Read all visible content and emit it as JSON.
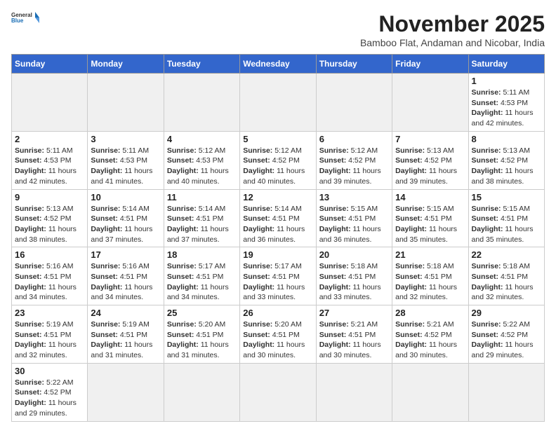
{
  "logo": {
    "line1": "General",
    "line2": "Blue"
  },
  "title": "November 2025",
  "subtitle": "Bamboo Flat, Andaman and Nicobar, India",
  "days_of_week": [
    "Sunday",
    "Monday",
    "Tuesday",
    "Wednesday",
    "Thursday",
    "Friday",
    "Saturday"
  ],
  "weeks": [
    [
      {
        "day": null,
        "info": null
      },
      {
        "day": null,
        "info": null
      },
      {
        "day": null,
        "info": null
      },
      {
        "day": null,
        "info": null
      },
      {
        "day": null,
        "info": null
      },
      {
        "day": null,
        "info": null
      },
      {
        "day": "1",
        "info": "Sunrise: 5:11 AM\nSunset: 4:53 PM\nDaylight: 11 hours and 42 minutes."
      }
    ],
    [
      {
        "day": "2",
        "info": "Sunrise: 5:11 AM\nSunset: 4:53 PM\nDaylight: 11 hours and 42 minutes."
      },
      {
        "day": "3",
        "info": "Sunrise: 5:11 AM\nSunset: 4:53 PM\nDaylight: 11 hours and 41 minutes."
      },
      {
        "day": "4",
        "info": "Sunrise: 5:12 AM\nSunset: 4:53 PM\nDaylight: 11 hours and 40 minutes."
      },
      {
        "day": "5",
        "info": "Sunrise: 5:12 AM\nSunset: 4:52 PM\nDaylight: 11 hours and 40 minutes."
      },
      {
        "day": "6",
        "info": "Sunrise: 5:12 AM\nSunset: 4:52 PM\nDaylight: 11 hours and 39 minutes."
      },
      {
        "day": "7",
        "info": "Sunrise: 5:13 AM\nSunset: 4:52 PM\nDaylight: 11 hours and 39 minutes."
      },
      {
        "day": "8",
        "info": "Sunrise: 5:13 AM\nSunset: 4:52 PM\nDaylight: 11 hours and 38 minutes."
      }
    ],
    [
      {
        "day": "9",
        "info": "Sunrise: 5:13 AM\nSunset: 4:52 PM\nDaylight: 11 hours and 38 minutes."
      },
      {
        "day": "10",
        "info": "Sunrise: 5:14 AM\nSunset: 4:51 PM\nDaylight: 11 hours and 37 minutes."
      },
      {
        "day": "11",
        "info": "Sunrise: 5:14 AM\nSunset: 4:51 PM\nDaylight: 11 hours and 37 minutes."
      },
      {
        "day": "12",
        "info": "Sunrise: 5:14 AM\nSunset: 4:51 PM\nDaylight: 11 hours and 36 minutes."
      },
      {
        "day": "13",
        "info": "Sunrise: 5:15 AM\nSunset: 4:51 PM\nDaylight: 11 hours and 36 minutes."
      },
      {
        "day": "14",
        "info": "Sunrise: 5:15 AM\nSunset: 4:51 PM\nDaylight: 11 hours and 35 minutes."
      },
      {
        "day": "15",
        "info": "Sunrise: 5:15 AM\nSunset: 4:51 PM\nDaylight: 11 hours and 35 minutes."
      }
    ],
    [
      {
        "day": "16",
        "info": "Sunrise: 5:16 AM\nSunset: 4:51 PM\nDaylight: 11 hours and 34 minutes."
      },
      {
        "day": "17",
        "info": "Sunrise: 5:16 AM\nSunset: 4:51 PM\nDaylight: 11 hours and 34 minutes."
      },
      {
        "day": "18",
        "info": "Sunrise: 5:17 AM\nSunset: 4:51 PM\nDaylight: 11 hours and 34 minutes."
      },
      {
        "day": "19",
        "info": "Sunrise: 5:17 AM\nSunset: 4:51 PM\nDaylight: 11 hours and 33 minutes."
      },
      {
        "day": "20",
        "info": "Sunrise: 5:18 AM\nSunset: 4:51 PM\nDaylight: 11 hours and 33 minutes."
      },
      {
        "day": "21",
        "info": "Sunrise: 5:18 AM\nSunset: 4:51 PM\nDaylight: 11 hours and 32 minutes."
      },
      {
        "day": "22",
        "info": "Sunrise: 5:18 AM\nSunset: 4:51 PM\nDaylight: 11 hours and 32 minutes."
      }
    ],
    [
      {
        "day": "23",
        "info": "Sunrise: 5:19 AM\nSunset: 4:51 PM\nDaylight: 11 hours and 32 minutes."
      },
      {
        "day": "24",
        "info": "Sunrise: 5:19 AM\nSunset: 4:51 PM\nDaylight: 11 hours and 31 minutes."
      },
      {
        "day": "25",
        "info": "Sunrise: 5:20 AM\nSunset: 4:51 PM\nDaylight: 11 hours and 31 minutes."
      },
      {
        "day": "26",
        "info": "Sunrise: 5:20 AM\nSunset: 4:51 PM\nDaylight: 11 hours and 30 minutes."
      },
      {
        "day": "27",
        "info": "Sunrise: 5:21 AM\nSunset: 4:51 PM\nDaylight: 11 hours and 30 minutes."
      },
      {
        "day": "28",
        "info": "Sunrise: 5:21 AM\nSunset: 4:52 PM\nDaylight: 11 hours and 30 minutes."
      },
      {
        "day": "29",
        "info": "Sunrise: 5:22 AM\nSunset: 4:52 PM\nDaylight: 11 hours and 29 minutes."
      }
    ],
    [
      {
        "day": "30",
        "info": "Sunrise: 5:22 AM\nSunset: 4:52 PM\nDaylight: 11 hours and 29 minutes."
      },
      {
        "day": null,
        "info": null
      },
      {
        "day": null,
        "info": null
      },
      {
        "day": null,
        "info": null
      },
      {
        "day": null,
        "info": null
      },
      {
        "day": null,
        "info": null
      },
      {
        "day": null,
        "info": null
      }
    ]
  ]
}
